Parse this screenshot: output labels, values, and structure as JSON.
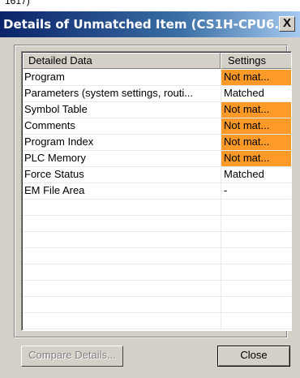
{
  "top_fragment": "1617)",
  "window": {
    "title": "Details of Unmatched Item (CS1H-CPU6...",
    "close_glyph": "X"
  },
  "table": {
    "columns": [
      "Detailed Data",
      "Settings"
    ],
    "rows": [
      {
        "item": "Program",
        "setting": "Not mat...",
        "status": "unmatched"
      },
      {
        "item": "Parameters (system settings, routi...",
        "setting": "Matched",
        "status": "matched"
      },
      {
        "item": "Symbol Table",
        "setting": "Not mat...",
        "status": "unmatched"
      },
      {
        "item": "Comments",
        "setting": "Not mat...",
        "status": "unmatched"
      },
      {
        "item": "Program Index",
        "setting": "Not mat...",
        "status": "unmatched"
      },
      {
        "item": "PLC Memory",
        "setting": "Not mat...",
        "status": "unmatched"
      },
      {
        "item": "Force Status",
        "setting": "Matched",
        "status": "matched"
      },
      {
        "item": "EM File Area",
        "setting": "-",
        "status": "na"
      }
    ],
    "unmatched_color": "#ff9a29"
  },
  "buttons": {
    "compare_details": "Compare Details...",
    "close": "Close"
  }
}
